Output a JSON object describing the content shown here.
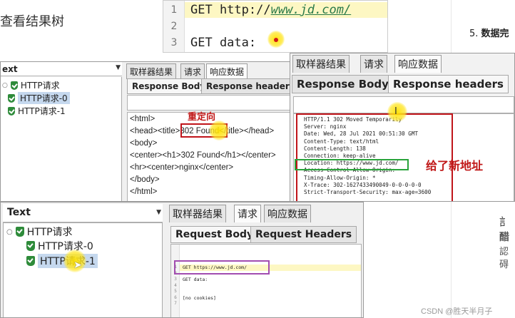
{
  "background": {
    "left_heading": "查看结果树",
    "step_number": "5.",
    "step_text": "数据完",
    "watermark": "CSDN @胜天半月子"
  },
  "code_panel": {
    "lines": [
      {
        "num": "1",
        "prefix": "GET http://",
        "url": "www.jd.com/"
      },
      {
        "num": "2",
        "text": ""
      },
      {
        "num": "3",
        "text": "GET data:"
      }
    ]
  },
  "window1": {
    "tree_header": "ext",
    "tree_items": [
      "HTTP请求",
      "HTTP请求-0",
      "HTTP请求-1"
    ],
    "tabs": [
      "取样器结果",
      "请求",
      "响应数据"
    ],
    "subtabs": [
      "Response Body",
      "Response headers"
    ],
    "body_lines": [
      "<html>",
      "<head><title>302 Found</title></head>",
      "<body>",
      "<center><h1>302 Found</h1></center>",
      "<hr><center>nginx</center>",
      "</body>",
      "</html>"
    ],
    "annotation": "重定向"
  },
  "window2": {
    "tabs": [
      "取样器结果",
      "请求",
      "响应数据"
    ],
    "subtabs": [
      "Response Body",
      "Response headers"
    ],
    "header_lines": [
      "HTTP/1.1 302 Moved Temporarily",
      "Server: nginx",
      "Date: Wed, 28 Jul 2021 00:51:30 GMT",
      "Content-Type: text/html",
      "Content-Length: 138",
      "Connection: keep-alive",
      "Location: https://www.jd.com/",
      "Access-Control-Allow-Origin:",
      "Timing-Allow-Origin: *",
      "X-Trace: 302-1627433490049-0-0-0-0-0",
      "Strict-Transport-Security: max-age=3600"
    ],
    "annotation": "给了新地址"
  },
  "window3": {
    "tree_header": "Text",
    "tree_items": [
      "HTTP请求",
      "HTTP请求-0",
      "HTTP请求-1"
    ],
    "tabs": [
      "取样器结果",
      "请求",
      "响应数据"
    ],
    "subtabs": [
      "Request Body",
      "Request Headers"
    ],
    "request_lines": [
      {
        "num": "1",
        "text": "GET https://www.jd.com/"
      },
      {
        "num": "2",
        "text": ""
      },
      {
        "num": "3",
        "text": "GET data:"
      },
      {
        "num": "4",
        "text": ""
      },
      {
        "num": "5",
        "text": ""
      },
      {
        "num": "6",
        "text": "[no cookies]"
      },
      {
        "num": "7",
        "text": ""
      }
    ]
  },
  "colors": {
    "annotation_red": "#c0141a",
    "annotation_green": "#29a33a",
    "annotation_purple": "#a24db0",
    "highlight_yellow": "#fdf7c3"
  }
}
